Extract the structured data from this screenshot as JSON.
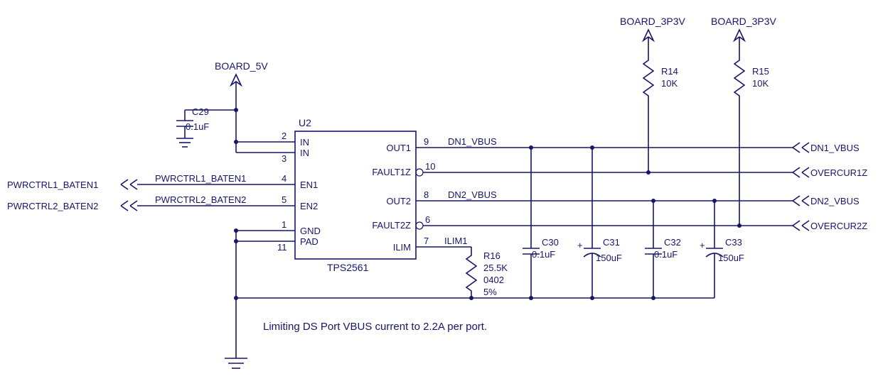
{
  "power_rails": {
    "board_5v": "BOARD_5V",
    "board_3p3v_a": "BOARD_3P3V",
    "board_3p3v_b": "BOARD_3P3V"
  },
  "ic": {
    "refdes": "U2",
    "part": "TPS2561",
    "pins": {
      "in1": {
        "num": "2",
        "name": "IN"
      },
      "in2": {
        "num": "3",
        "name": "IN"
      },
      "en1": {
        "num": "4",
        "name": "EN1"
      },
      "en2": {
        "num": "5",
        "name": "EN2"
      },
      "gnd": {
        "num": "1",
        "name": "GND"
      },
      "pad": {
        "num": "11",
        "name": "PAD"
      },
      "out1": {
        "num": "9",
        "name": "OUT1"
      },
      "fault1": {
        "num": "10",
        "name": "FAULT1Z"
      },
      "out2": {
        "num": "8",
        "name": "OUT2"
      },
      "fault2": {
        "num": "6",
        "name": "FAULT2Z"
      },
      "ilim": {
        "num": "7",
        "name": "ILIM"
      }
    }
  },
  "nets": {
    "dn1_vbus": "DN1_VBUS",
    "dn2_vbus": "DN2_VBUS",
    "ilim1": "ILIM1",
    "pwrctrl1": "PWRCTRL1_BATEN1",
    "pwrctrl2": "PWRCTRL2_BATEN2"
  },
  "offpage_left": {
    "pwrctrl1": "PWRCTRL1_BATEN1",
    "pwrctrl2": "PWRCTRL2_BATEN2"
  },
  "offpage_right": {
    "dn1_vbus": "DN1_VBUS",
    "overcur1z": "OVERCUR1Z",
    "dn2_vbus": "DN2_VBUS",
    "overcur2z": "OVERCUR2Z"
  },
  "components": {
    "C29": {
      "ref": "C29",
      "value": "0.1uF"
    },
    "R14": {
      "ref": "R14",
      "value": "10K"
    },
    "R15": {
      "ref": "R15",
      "value": "10K"
    },
    "C30": {
      "ref": "C30",
      "value": "0.1uF"
    },
    "C31": {
      "ref": "C31",
      "value": "150uF"
    },
    "C32": {
      "ref": "C32",
      "value": "0.1uF"
    },
    "C33": {
      "ref": "C33",
      "value": "150uF"
    },
    "R16": {
      "ref": "R16",
      "val1": "25.5K",
      "val2": "0402",
      "val3": "5%"
    }
  },
  "note": "Limiting DS Port VBUS current to 2.2A per port."
}
